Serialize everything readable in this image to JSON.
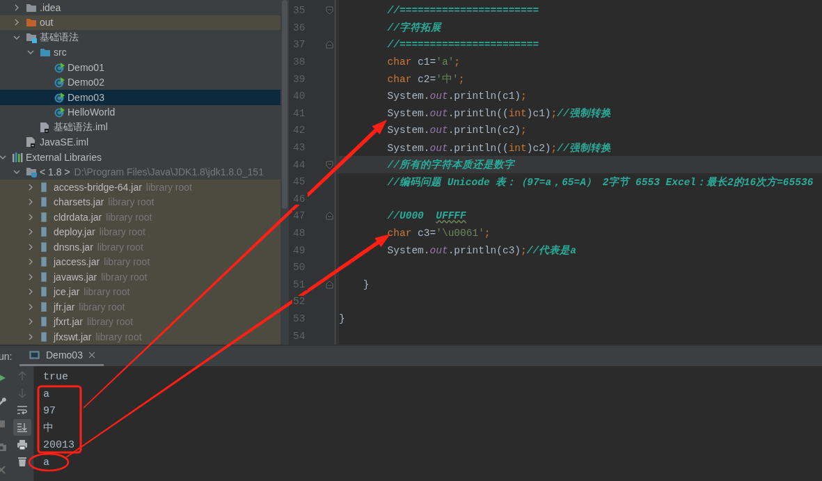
{
  "tree": {
    "root_children": [
      {
        "label": ".idea",
        "kind": "folder",
        "expanded": false,
        "selected": false,
        "tinted": false
      },
      {
        "label": "out",
        "kind": "excluded-folder",
        "expanded": false,
        "selected": false,
        "tinted": true
      },
      {
        "label": "基础语法",
        "kind": "module",
        "expanded": true,
        "selected": false,
        "tinted": false,
        "children": [
          {
            "label": "src",
            "kind": "source-folder",
            "expanded": true,
            "selected": false,
            "tinted": false,
            "children": [
              {
                "label": "Demo01",
                "kind": "class",
                "selected": false,
                "tinted": false
              },
              {
                "label": "Demo02",
                "kind": "class",
                "selected": false,
                "tinted": false
              },
              {
                "label": "Demo03",
                "kind": "class",
                "selected": true,
                "tinted": false
              },
              {
                "label": "HelloWorld",
                "kind": "class",
                "selected": false,
                "tinted": false
              }
            ]
          },
          {
            "label": "基础语法.iml",
            "kind": "iml",
            "selected": false,
            "tinted": false
          }
        ]
      },
      {
        "label": "JavaSE.iml",
        "kind": "iml",
        "selected": false,
        "tinted": false
      }
    ],
    "items": [
      {
        "label": "External Libraries",
        "kind": "libraries",
        "expanded": true,
        "selected": false,
        "tinted": false,
        "children": [
          {
            "label": "< 1.8 >",
            "detail": "D:\\Program Files\\Java\\JDK1.8\\jdk1.8.0_151",
            "kind": "jdk",
            "expanded": true,
            "selected": false,
            "tinted": false,
            "children": [
              {
                "label": "access-bridge-64.jar",
                "detail": "library root",
                "kind": "jar",
                "expanded": false,
                "selected": false,
                "tinted": true
              },
              {
                "label": "charsets.jar",
                "detail": "library root",
                "kind": "jar",
                "expanded": false,
                "selected": false,
                "tinted": true
              },
              {
                "label": "cldrdata.jar",
                "detail": "library root",
                "kind": "jar",
                "expanded": false,
                "selected": false,
                "tinted": true
              },
              {
                "label": "deploy.jar",
                "detail": "library root",
                "kind": "jar",
                "expanded": false,
                "selected": false,
                "tinted": true
              },
              {
                "label": "dnsns.jar",
                "detail": "library root",
                "kind": "jar",
                "expanded": false,
                "selected": false,
                "tinted": true
              },
              {
                "label": "jaccess.jar",
                "detail": "library root",
                "kind": "jar",
                "expanded": false,
                "selected": false,
                "tinted": true
              },
              {
                "label": "javaws.jar",
                "detail": "library root",
                "kind": "jar",
                "expanded": false,
                "selected": false,
                "tinted": true
              },
              {
                "label": "jce.jar",
                "detail": "library root",
                "kind": "jar",
                "expanded": false,
                "selected": false,
                "tinted": true
              },
              {
                "label": "jfr.jar",
                "detail": "library root",
                "kind": "jar",
                "expanded": false,
                "selected": false,
                "tinted": true
              },
              {
                "label": "jfxrt.jar",
                "detail": "library root",
                "kind": "jar",
                "expanded": false,
                "selected": false,
                "tinted": true
              },
              {
                "label": "jfxswt.jar",
                "detail": "library root",
                "kind": "jar",
                "expanded": false,
                "selected": false,
                "tinted": true
              }
            ]
          }
        ]
      }
    ]
  },
  "editor": {
    "lines": [
      {
        "number": "35",
        "kind": "fold-start",
        "current": false,
        "tokens": [
          {
            "kind": "comment",
            "text": "        //======================="
          }
        ]
      },
      {
        "number": "36",
        "kind": "code",
        "current": false,
        "tokens": [
          {
            "kind": "comment",
            "text": "        //字符拓展"
          }
        ]
      },
      {
        "number": "37",
        "kind": "fold-end",
        "current": false,
        "tokens": [
          {
            "kind": "comment",
            "text": "        //======================="
          }
        ]
      },
      {
        "number": "38",
        "kind": "code",
        "current": false,
        "tokens": [
          {
            "kind": "keyword",
            "text": "        char"
          },
          {
            "kind": "plain",
            "text": " c1="
          },
          {
            "kind": "string",
            "text": "'a'"
          },
          {
            "kind": "keyword",
            "text": ";"
          }
        ]
      },
      {
        "number": "39",
        "kind": "code",
        "current": false,
        "tokens": [
          {
            "kind": "keyword",
            "text": "        char"
          },
          {
            "kind": "plain",
            "text": " c2="
          },
          {
            "kind": "string",
            "text": "'中'"
          },
          {
            "kind": "keyword",
            "text": ";"
          }
        ]
      },
      {
        "number": "40",
        "kind": "code",
        "current": false,
        "tokens": [
          {
            "kind": "plain",
            "text": "        System."
          },
          {
            "kind": "field",
            "text": "out"
          },
          {
            "kind": "plain",
            "text": ".println(c1)"
          },
          {
            "kind": "keyword",
            "text": ";"
          }
        ]
      },
      {
        "number": "41",
        "kind": "code",
        "current": false,
        "tokens": [
          {
            "kind": "plain",
            "text": "        System."
          },
          {
            "kind": "field",
            "text": "out"
          },
          {
            "kind": "plain",
            "text": ".println(("
          },
          {
            "kind": "keyword",
            "text": "int"
          },
          {
            "kind": "plain",
            "text": ")c1)"
          },
          {
            "kind": "keyword",
            "text": ";"
          },
          {
            "kind": "comment",
            "text": "//强制转换"
          }
        ]
      },
      {
        "number": "42",
        "kind": "code",
        "current": false,
        "tokens": [
          {
            "kind": "plain",
            "text": "        System."
          },
          {
            "kind": "field",
            "text": "out"
          },
          {
            "kind": "plain",
            "text": ".println(c2)"
          },
          {
            "kind": "keyword",
            "text": ";"
          }
        ]
      },
      {
        "number": "43",
        "kind": "code",
        "current": false,
        "tokens": [
          {
            "kind": "plain",
            "text": "        System."
          },
          {
            "kind": "field",
            "text": "out"
          },
          {
            "kind": "plain",
            "text": ".println(("
          },
          {
            "kind": "keyword",
            "text": "int"
          },
          {
            "kind": "plain",
            "text": ")c2)"
          },
          {
            "kind": "keyword",
            "text": ";"
          },
          {
            "kind": "comment",
            "text": "//强制转换"
          }
        ]
      },
      {
        "number": "44",
        "kind": "fold-start",
        "current": true,
        "tokens": [
          {
            "kind": "comment",
            "text": "        //所有的字符本质还是数字"
          }
        ]
      },
      {
        "number": "45",
        "kind": "code",
        "current": false,
        "tokens": [
          {
            "kind": "comment",
            "text": "        //编码问题 Unicode 表：（97=a，65=A） 2字节 6553 Excel：最长2的16次方=65536"
          }
        ]
      },
      {
        "number": "46",
        "kind": "code",
        "current": false
      },
      {
        "number": "47",
        "kind": "fold-end",
        "current": false,
        "tokens": [
          {
            "kind": "comment",
            "text": "        //U000  "
          },
          {
            "kind": "comment-typo",
            "text": "UFFFF"
          }
        ]
      },
      {
        "number": "48",
        "kind": "code",
        "current": false,
        "tokens": [
          {
            "kind": "keyword",
            "text": "        char"
          },
          {
            "kind": "plain",
            "text": " c3="
          },
          {
            "kind": "string",
            "text": "'\\u0061'"
          },
          {
            "kind": "keyword",
            "text": ";"
          }
        ]
      },
      {
        "number": "49",
        "kind": "code",
        "current": false,
        "tokens": [
          {
            "kind": "plain",
            "text": "        System."
          },
          {
            "kind": "field",
            "text": "out"
          },
          {
            "kind": "plain",
            "text": ".println(c3)"
          },
          {
            "kind": "keyword",
            "text": ";"
          },
          {
            "kind": "comment",
            "text": "//代表是a"
          }
        ]
      },
      {
        "number": "50",
        "kind": "code",
        "current": false
      },
      {
        "number": "51",
        "kind": "fold-end",
        "current": false,
        "tokens": [
          {
            "kind": "plain",
            "text": "    }"
          }
        ]
      },
      {
        "number": "52",
        "kind": "code",
        "current": false
      },
      {
        "number": "53",
        "kind": "code",
        "current": false,
        "tokens": [
          {
            "kind": "plain",
            "text": "}"
          }
        ]
      },
      {
        "number": "54",
        "kind": "code",
        "current": false
      }
    ]
  },
  "run_panel": {
    "label": "un:",
    "tabs": [
      {
        "label": "Demo03",
        "selected": true
      }
    ],
    "side_toolbar": [
      {
        "kind": "run",
        "disabled": false
      },
      {
        "kind": "wrench",
        "disabled": false
      },
      {
        "kind": "stop",
        "disabled": true
      },
      {
        "kind": "camera",
        "disabled": true
      },
      {
        "kind": "exit",
        "disabled": true
      }
    ],
    "toolbar": [
      {
        "kind": "up",
        "disabled": true
      },
      {
        "kind": "down",
        "disabled": true
      },
      {
        "kind": "wrap",
        "on": false
      },
      {
        "kind": "scroll-end",
        "on": true
      },
      {
        "kind": "print"
      },
      {
        "kind": "trash"
      }
    ],
    "output": [
      "true",
      "a",
      "97",
      "中",
      "20013",
      "a"
    ]
  },
  "annotations": [
    {
      "kind": "arrow"
    },
    {
      "kind": "arrow"
    },
    {
      "kind": "box"
    },
    {
      "kind": "ellipse"
    }
  ]
}
